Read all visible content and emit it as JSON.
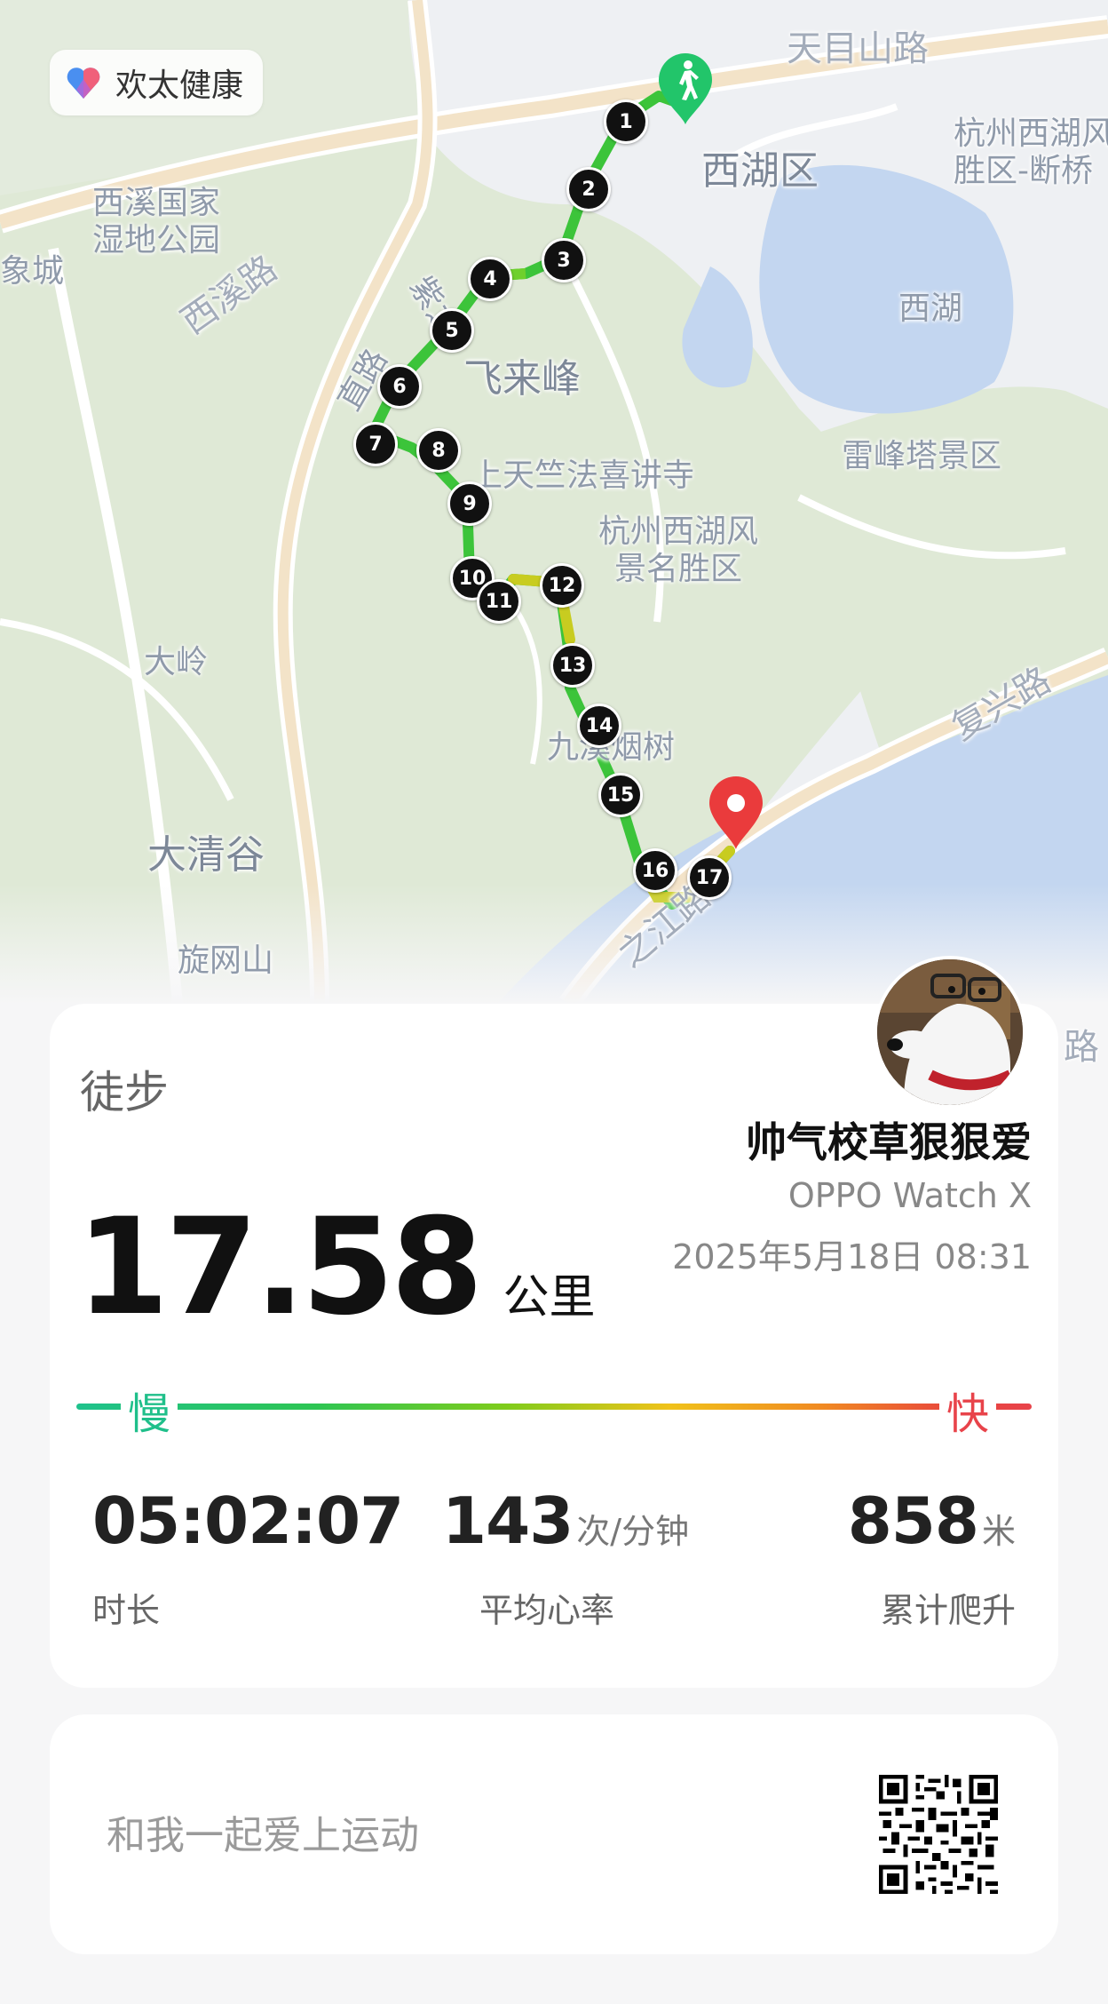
{
  "app": {
    "name": "欢太健康",
    "icon": "heart-icon"
  },
  "map": {
    "labels": {
      "tianmushan_road": "天目山路",
      "xihu_district": "西湖区",
      "scenic_duanqiao": "杭州西湖风\n胜区-断桥",
      "xixi_wetland": "西溪国家\n湿地公园",
      "xixi_road": "西溪路",
      "xiangcheng": "象城",
      "xihu_lake": "西湖",
      "ziyang": "紫之",
      "feilaifeng": "飞来峰",
      "lingyin": "直路",
      "leifeng": "雷峰塔景区",
      "shangtianzhu": "上天竺法喜讲寺",
      "scenic_area": "杭州西湖风\n景名胜区",
      "daling": "大岭",
      "fuxing_road": "复兴路",
      "jiuxi": "九溪烟树",
      "daqinggu": "大清谷",
      "xuanwangshan": "旋网山",
      "zhijiang": "之江路",
      "edge_road": "路"
    },
    "markers": [
      "1",
      "2",
      "3",
      "4",
      "5",
      "6",
      "7",
      "8",
      "9",
      "10",
      "11",
      "12",
      "13",
      "14",
      "15",
      "16",
      "17"
    ],
    "start_icon": "walking-person-icon",
    "end_icon": "location-pin-icon"
  },
  "workout": {
    "type": "徒步",
    "distance": "17.58",
    "distance_unit": "公里",
    "user_name": "帅气校草狠狠爱",
    "device": "OPPO Watch X",
    "datetime": "2025年5月18日 08:31"
  },
  "pace_legend": {
    "slow": "慢",
    "fast": "快"
  },
  "stats": {
    "duration": {
      "value": "05:02:07",
      "unit": "",
      "label": "时长"
    },
    "heart_rate": {
      "value": "143",
      "unit": "次/分钟",
      "label": "平均心率"
    },
    "climb": {
      "value": "858",
      "unit": "米",
      "label": "累计爬升"
    }
  },
  "share": {
    "text": "和我一起爱上运动",
    "qr_icon": "qr-code-icon"
  },
  "colors": {
    "route_green": "#3cc43a",
    "route_yellow": "#c8cc20",
    "pace_slow": "#1fbf8a",
    "pace_fast": "#e8434a"
  }
}
